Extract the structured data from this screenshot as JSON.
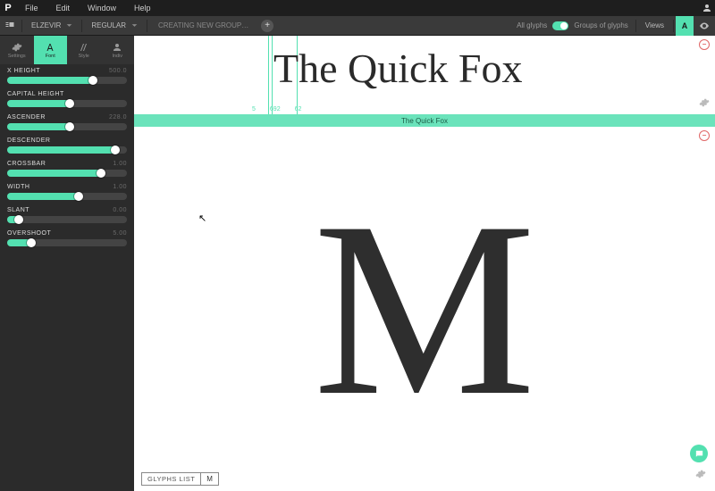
{
  "menubar": {
    "logo": "P",
    "items": [
      "File",
      "Edit",
      "Window",
      "Help"
    ]
  },
  "toolbar": {
    "font_family": "ELZEVIR",
    "font_variant": "REGULAR",
    "breadcrumb": "CREATING NEW GROUP…",
    "filter_all": "All glyphs",
    "filter_groups": "Groups of glyphs",
    "views_label": "Views",
    "mode_a": "A"
  },
  "sidebar": {
    "tabs": [
      {
        "label": "Settings"
      },
      {
        "label": "Font"
      },
      {
        "label": "Style"
      },
      {
        "label": "Indiv"
      }
    ],
    "params": [
      {
        "name": "X HEIGHT",
        "value": "500.0",
        "pct": 72
      },
      {
        "name": "CAPITAL HEIGHT",
        "value": "",
        "pct": 52
      },
      {
        "name": "ASCENDER",
        "value": "228.0",
        "pct": 52
      },
      {
        "name": "DESCENDER",
        "value": "",
        "pct": 90
      },
      {
        "name": "CROSSBAR",
        "value": "1.00",
        "pct": 78
      },
      {
        "name": "WIDTH",
        "value": "1.00",
        "pct": 60
      },
      {
        "name": "SLANT",
        "value": "0.00",
        "pct": 10
      },
      {
        "name": "OVERSHOOT",
        "value": "5.00",
        "pct": 20
      }
    ]
  },
  "preview": {
    "sample_text": "The Quick Fox",
    "metrics": [
      "5",
      "692",
      "62"
    ],
    "bar_label": "The Quick Fox"
  },
  "glyph": {
    "char": "M"
  },
  "bottom": {
    "label": "GLYPHS LIST",
    "current": "M"
  }
}
